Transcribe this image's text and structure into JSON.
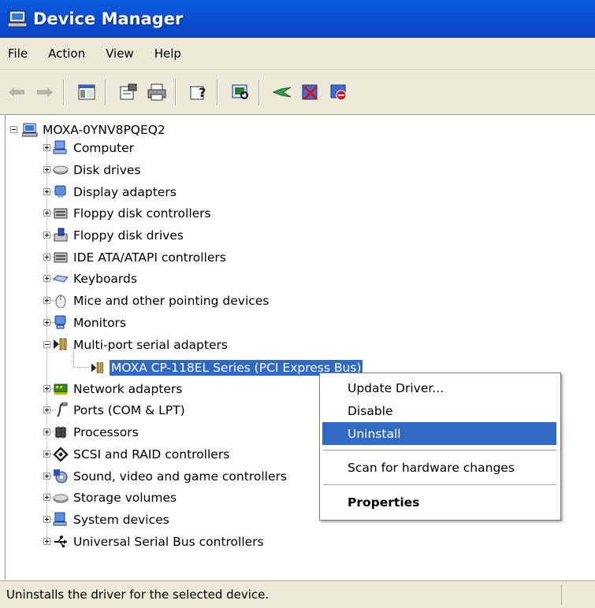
{
  "window": {
    "title": "Device Manager"
  },
  "menu": [
    "File",
    "Action",
    "View",
    "Help"
  ],
  "toolbar": {
    "buttons": [
      "back-arrow-icon",
      "forward-arrow-icon",
      "show-hide-console-tree-icon",
      "properties-icon",
      "print-icon",
      "help-icon",
      "scan-hardware-icon",
      "update-driver-icon",
      "uninstall-icon",
      "disable-icon"
    ]
  },
  "tree": {
    "root": "MOXA-0YNV8PQEQ2",
    "categories": [
      "Computer",
      "Disk drives",
      "Display adapters",
      "Floppy disk controllers",
      "Floppy disk drives",
      "IDE ATA/ATAPI controllers",
      "Keyboards",
      "Mice and other pointing devices",
      "Monitors",
      "Multi-port serial adapters",
      "Network adapters",
      "Ports (COM & LPT)",
      "Processors",
      "SCSI and RAID controllers",
      "Sound, video and game controllers",
      "Storage volumes",
      "System devices",
      "Universal Serial Bus controllers"
    ],
    "selected_device": "MOXA CP-118EL Series (PCI Express Bus)"
  },
  "context_menu": {
    "update_driver": "Update Driver...",
    "disable": "Disable",
    "uninstall": "Uninstall",
    "scan": "Scan for hardware changes",
    "properties": "Properties"
  },
  "status": {
    "text": "Uninstalls the driver for the selected device."
  },
  "colors": {
    "title_bar": "#0b4fd4",
    "selection": "#316ac5",
    "chrome": "#ece9d8"
  }
}
